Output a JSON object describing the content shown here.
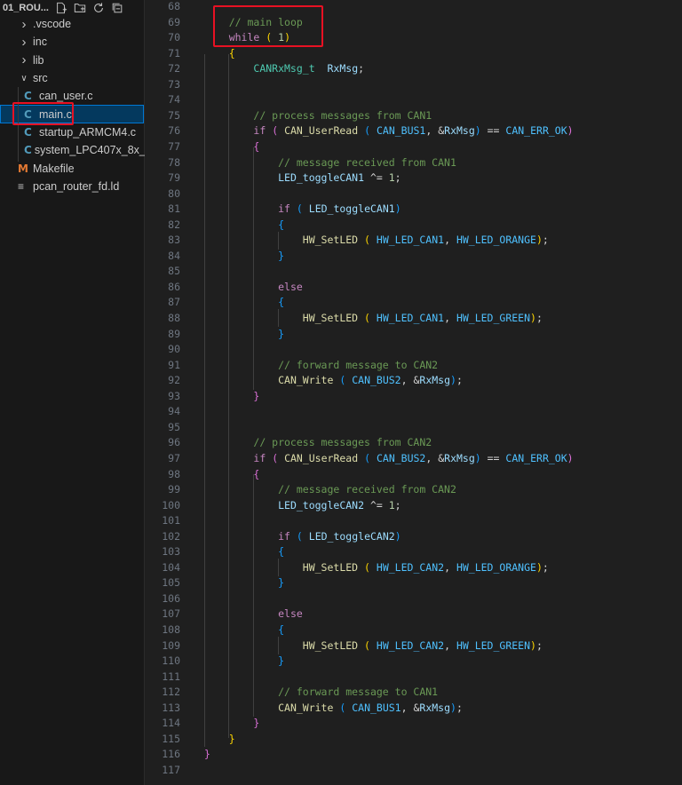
{
  "explorer": {
    "title": "01_ROU...",
    "items": [
      {
        "label": ".vscode",
        "kind": "folder",
        "indent": 1,
        "expanded": false,
        "selected": false
      },
      {
        "label": "inc",
        "kind": "folder",
        "indent": 1,
        "expanded": false,
        "selected": false
      },
      {
        "label": "lib",
        "kind": "folder",
        "indent": 1,
        "expanded": false,
        "selected": false
      },
      {
        "label": "src",
        "kind": "folder",
        "indent": 1,
        "expanded": true,
        "selected": false
      },
      {
        "label": "can_user.c",
        "kind": "c-file",
        "indent": 2,
        "selected": false
      },
      {
        "label": "main.c",
        "kind": "c-file",
        "indent": 2,
        "selected": true
      },
      {
        "label": "startup_ARMCM4.c",
        "kind": "c-file",
        "indent": 2,
        "selected": false
      },
      {
        "label": "system_LPC407x_8x_...",
        "kind": "c-file",
        "indent": 2,
        "selected": false
      },
      {
        "label": "Makefile",
        "kind": "makefile",
        "indent": 1,
        "selected": false
      },
      {
        "label": "pcan_router_fd.ld",
        "kind": "ld-file",
        "indent": 1,
        "selected": false
      }
    ],
    "icons": [
      "new-file-icon",
      "new-folder-icon",
      "refresh-icon",
      "collapse-all-icon"
    ]
  },
  "editor": {
    "colors": {
      "keyword": "#c586c0",
      "type": "#4ec9b0",
      "function": "#dcdcaa",
      "variable": "#9cdcfe",
      "constant": "#4fc1ff",
      "number": "#b5cea8",
      "comment": "#6a9955",
      "annotation": "#e81123"
    },
    "lines": [
      {
        "n": "68",
        "t": []
      },
      {
        "n": "69",
        "t": [
          [
            "    ",
            ""
          ],
          [
            "// main loop",
            "cm"
          ]
        ]
      },
      {
        "n": "70",
        "t": [
          [
            "    ",
            ""
          ],
          [
            "while",
            "kw"
          ],
          [
            " ",
            ""
          ],
          [
            "(",
            "b0"
          ],
          [
            " ",
            ""
          ],
          [
            "1",
            "num"
          ],
          [
            ")",
            "b0"
          ]
        ]
      },
      {
        "n": "71",
        "t": [
          [
            "    ",
            ""
          ],
          [
            "{",
            "b0"
          ]
        ]
      },
      {
        "n": "72",
        "t": [
          [
            "        ",
            ""
          ],
          [
            "CANRxMsg_t",
            "ty"
          ],
          [
            "  ",
            ""
          ],
          [
            "RxMsg",
            "var"
          ],
          [
            ";",
            "op"
          ]
        ]
      },
      {
        "n": "73",
        "t": []
      },
      {
        "n": "74",
        "t": []
      },
      {
        "n": "75",
        "t": [
          [
            "        ",
            ""
          ],
          [
            "// process messages from CAN1",
            "cm"
          ]
        ]
      },
      {
        "n": "76",
        "t": [
          [
            "        ",
            ""
          ],
          [
            "if",
            "kw"
          ],
          [
            " ",
            ""
          ],
          [
            "(",
            "b1"
          ],
          [
            " ",
            ""
          ],
          [
            "CAN_UserRead",
            "fn"
          ],
          [
            " ",
            ""
          ],
          [
            "(",
            "b2"
          ],
          [
            " ",
            ""
          ],
          [
            "CAN_BUS1",
            "const"
          ],
          [
            ", &",
            "op"
          ],
          [
            "RxMsg",
            "var"
          ],
          [
            ")",
            "b2"
          ],
          [
            " == ",
            "op"
          ],
          [
            "CAN_ERR_OK",
            "const"
          ],
          [
            ")",
            "b1"
          ]
        ]
      },
      {
        "n": "77",
        "t": [
          [
            "        ",
            ""
          ],
          [
            "{",
            "b1"
          ]
        ]
      },
      {
        "n": "78",
        "t": [
          [
            "            ",
            ""
          ],
          [
            "// message received from CAN1",
            "cm"
          ]
        ]
      },
      {
        "n": "79",
        "t": [
          [
            "            ",
            ""
          ],
          [
            "LED_toggleCAN1",
            "var"
          ],
          [
            " ^= ",
            "op"
          ],
          [
            "1",
            "num"
          ],
          [
            ";",
            "op"
          ]
        ]
      },
      {
        "n": "80",
        "t": []
      },
      {
        "n": "81",
        "t": [
          [
            "            ",
            ""
          ],
          [
            "if",
            "kw"
          ],
          [
            " ",
            ""
          ],
          [
            "(",
            "b2"
          ],
          [
            " ",
            ""
          ],
          [
            "LED_toggleCAN1",
            "var"
          ],
          [
            ")",
            "b2"
          ]
        ]
      },
      {
        "n": "82",
        "t": [
          [
            "            ",
            ""
          ],
          [
            "{",
            "b2"
          ]
        ]
      },
      {
        "n": "83",
        "t": [
          [
            "                ",
            ""
          ],
          [
            "HW_SetLED",
            "fn"
          ],
          [
            " ",
            ""
          ],
          [
            "(",
            "b0"
          ],
          [
            " ",
            ""
          ],
          [
            "HW_LED_CAN1",
            "const"
          ],
          [
            ", ",
            "op"
          ],
          [
            "HW_LED_ORANGE",
            "const"
          ],
          [
            ")",
            "b0"
          ],
          [
            ";",
            "op"
          ]
        ]
      },
      {
        "n": "84",
        "t": [
          [
            "            ",
            ""
          ],
          [
            "}",
            "b2"
          ]
        ]
      },
      {
        "n": "85",
        "t": []
      },
      {
        "n": "86",
        "t": [
          [
            "            ",
            ""
          ],
          [
            "else",
            "kw"
          ]
        ]
      },
      {
        "n": "87",
        "t": [
          [
            "            ",
            ""
          ],
          [
            "{",
            "b2"
          ]
        ]
      },
      {
        "n": "88",
        "t": [
          [
            "                ",
            ""
          ],
          [
            "HW_SetLED",
            "fn"
          ],
          [
            " ",
            ""
          ],
          [
            "(",
            "b0"
          ],
          [
            " ",
            ""
          ],
          [
            "HW_LED_CAN1",
            "const"
          ],
          [
            ", ",
            "op"
          ],
          [
            "HW_LED_GREEN",
            "const"
          ],
          [
            ")",
            "b0"
          ],
          [
            ";",
            "op"
          ]
        ]
      },
      {
        "n": "89",
        "t": [
          [
            "            ",
            ""
          ],
          [
            "}",
            "b2"
          ]
        ]
      },
      {
        "n": "90",
        "t": []
      },
      {
        "n": "91",
        "t": [
          [
            "            ",
            ""
          ],
          [
            "// forward message to CAN2",
            "cm"
          ]
        ]
      },
      {
        "n": "92",
        "t": [
          [
            "            ",
            ""
          ],
          [
            "CAN_Write",
            "fn"
          ],
          [
            " ",
            ""
          ],
          [
            "(",
            "b2"
          ],
          [
            " ",
            ""
          ],
          [
            "CAN_BUS2",
            "const"
          ],
          [
            ", &",
            "op"
          ],
          [
            "RxMsg",
            "var"
          ],
          [
            ")",
            "b2"
          ],
          [
            ";",
            "op"
          ]
        ]
      },
      {
        "n": "93",
        "t": [
          [
            "        ",
            ""
          ],
          [
            "}",
            "b1"
          ]
        ]
      },
      {
        "n": "94",
        "t": []
      },
      {
        "n": "95",
        "t": []
      },
      {
        "n": "96",
        "t": [
          [
            "        ",
            ""
          ],
          [
            "// process messages from CAN2",
            "cm"
          ]
        ]
      },
      {
        "n": "97",
        "t": [
          [
            "        ",
            ""
          ],
          [
            "if",
            "kw"
          ],
          [
            " ",
            ""
          ],
          [
            "(",
            "b1"
          ],
          [
            " ",
            ""
          ],
          [
            "CAN_UserRead",
            "fn"
          ],
          [
            " ",
            ""
          ],
          [
            "(",
            "b2"
          ],
          [
            " ",
            ""
          ],
          [
            "CAN_BUS2",
            "const"
          ],
          [
            ", &",
            "op"
          ],
          [
            "RxMsg",
            "var"
          ],
          [
            ")",
            "b2"
          ],
          [
            " == ",
            "op"
          ],
          [
            "CAN_ERR_OK",
            "const"
          ],
          [
            ")",
            "b1"
          ]
        ]
      },
      {
        "n": "98",
        "t": [
          [
            "        ",
            ""
          ],
          [
            "{",
            "b1"
          ]
        ]
      },
      {
        "n": "99",
        "t": [
          [
            "            ",
            ""
          ],
          [
            "// message received from CAN2",
            "cm"
          ]
        ]
      },
      {
        "n": "100",
        "t": [
          [
            "            ",
            ""
          ],
          [
            "LED_toggleCAN2",
            "var"
          ],
          [
            " ^= ",
            "op"
          ],
          [
            "1",
            "num"
          ],
          [
            ";",
            "op"
          ]
        ]
      },
      {
        "n": "101",
        "t": []
      },
      {
        "n": "102",
        "t": [
          [
            "            ",
            ""
          ],
          [
            "if",
            "kw"
          ],
          [
            " ",
            ""
          ],
          [
            "(",
            "b2"
          ],
          [
            " ",
            ""
          ],
          [
            "LED_toggleCAN2",
            "var"
          ],
          [
            ")",
            "b2"
          ]
        ]
      },
      {
        "n": "103",
        "t": [
          [
            "            ",
            ""
          ],
          [
            "{",
            "b2"
          ]
        ]
      },
      {
        "n": "104",
        "t": [
          [
            "                ",
            ""
          ],
          [
            "HW_SetLED",
            "fn"
          ],
          [
            " ",
            ""
          ],
          [
            "(",
            "b0"
          ],
          [
            " ",
            ""
          ],
          [
            "HW_LED_CAN2",
            "const"
          ],
          [
            ", ",
            "op"
          ],
          [
            "HW_LED_ORANGE",
            "const"
          ],
          [
            ")",
            "b0"
          ],
          [
            ";",
            "op"
          ]
        ]
      },
      {
        "n": "105",
        "t": [
          [
            "            ",
            ""
          ],
          [
            "}",
            "b2"
          ]
        ]
      },
      {
        "n": "106",
        "t": []
      },
      {
        "n": "107",
        "t": [
          [
            "            ",
            ""
          ],
          [
            "else",
            "kw"
          ]
        ]
      },
      {
        "n": "108",
        "t": [
          [
            "            ",
            ""
          ],
          [
            "{",
            "b2"
          ]
        ]
      },
      {
        "n": "109",
        "t": [
          [
            "                ",
            ""
          ],
          [
            "HW_SetLED",
            "fn"
          ],
          [
            " ",
            ""
          ],
          [
            "(",
            "b0"
          ],
          [
            " ",
            ""
          ],
          [
            "HW_LED_CAN2",
            "const"
          ],
          [
            ", ",
            "op"
          ],
          [
            "HW_LED_GREEN",
            "const"
          ],
          [
            ")",
            "b0"
          ],
          [
            ";",
            "op"
          ]
        ]
      },
      {
        "n": "110",
        "t": [
          [
            "            ",
            ""
          ],
          [
            "}",
            "b2"
          ]
        ]
      },
      {
        "n": "111",
        "t": []
      },
      {
        "n": "112",
        "t": [
          [
            "            ",
            ""
          ],
          [
            "// forward message to CAN1",
            "cm"
          ]
        ]
      },
      {
        "n": "113",
        "t": [
          [
            "            ",
            ""
          ],
          [
            "CAN_Write",
            "fn"
          ],
          [
            " ",
            ""
          ],
          [
            "(",
            "b2"
          ],
          [
            " ",
            ""
          ],
          [
            "CAN_BUS1",
            "const"
          ],
          [
            ", &",
            "op"
          ],
          [
            "RxMsg",
            "var"
          ],
          [
            ")",
            "b2"
          ],
          [
            ";",
            "op"
          ]
        ]
      },
      {
        "n": "114",
        "t": [
          [
            "        ",
            ""
          ],
          [
            "}",
            "b1"
          ]
        ]
      },
      {
        "n": "115",
        "t": [
          [
            "    ",
            ""
          ],
          [
            "}",
            "b0"
          ]
        ]
      },
      {
        "n": "116",
        "t": [
          [
            "",
            ""
          ],
          [
            "}",
            "b1"
          ]
        ]
      },
      {
        "n": "117",
        "t": []
      }
    ]
  }
}
